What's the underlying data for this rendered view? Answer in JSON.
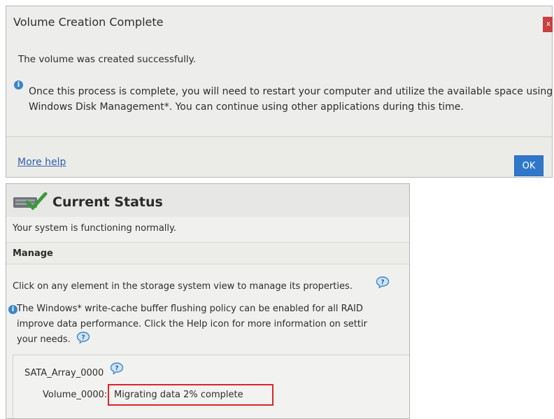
{
  "dialog": {
    "title": "Volume Creation Complete",
    "close_label": "x",
    "message": "The volume was created successfully.",
    "info_line1": "Once this process is complete, you will need to restart your computer and utilize the available space using",
    "info_line2": "Windows Disk Management*. You can continue using other applications during this time.",
    "more_help": "More help",
    "ok_label": "OK"
  },
  "status": {
    "title": "Current Status",
    "summary": "Your system is functioning normally.",
    "manage_heading": "Manage",
    "manage_text": "Click on any element in the storage system view to manage its properties.",
    "info_line1": "The Windows* write-cache buffer flushing policy can be enabled for all RAID",
    "info_line2": "improve data performance. Click the Help icon for more information on settir",
    "info_line3": "your needs.",
    "array_name": "SATA_Array_0000",
    "volume_name": "Volume_0000:",
    "volume_status": "Migrating data 2% complete"
  },
  "colors": {
    "accent": "#2f78c9",
    "highlight": "#d9262a",
    "link": "#2f5fb0"
  }
}
